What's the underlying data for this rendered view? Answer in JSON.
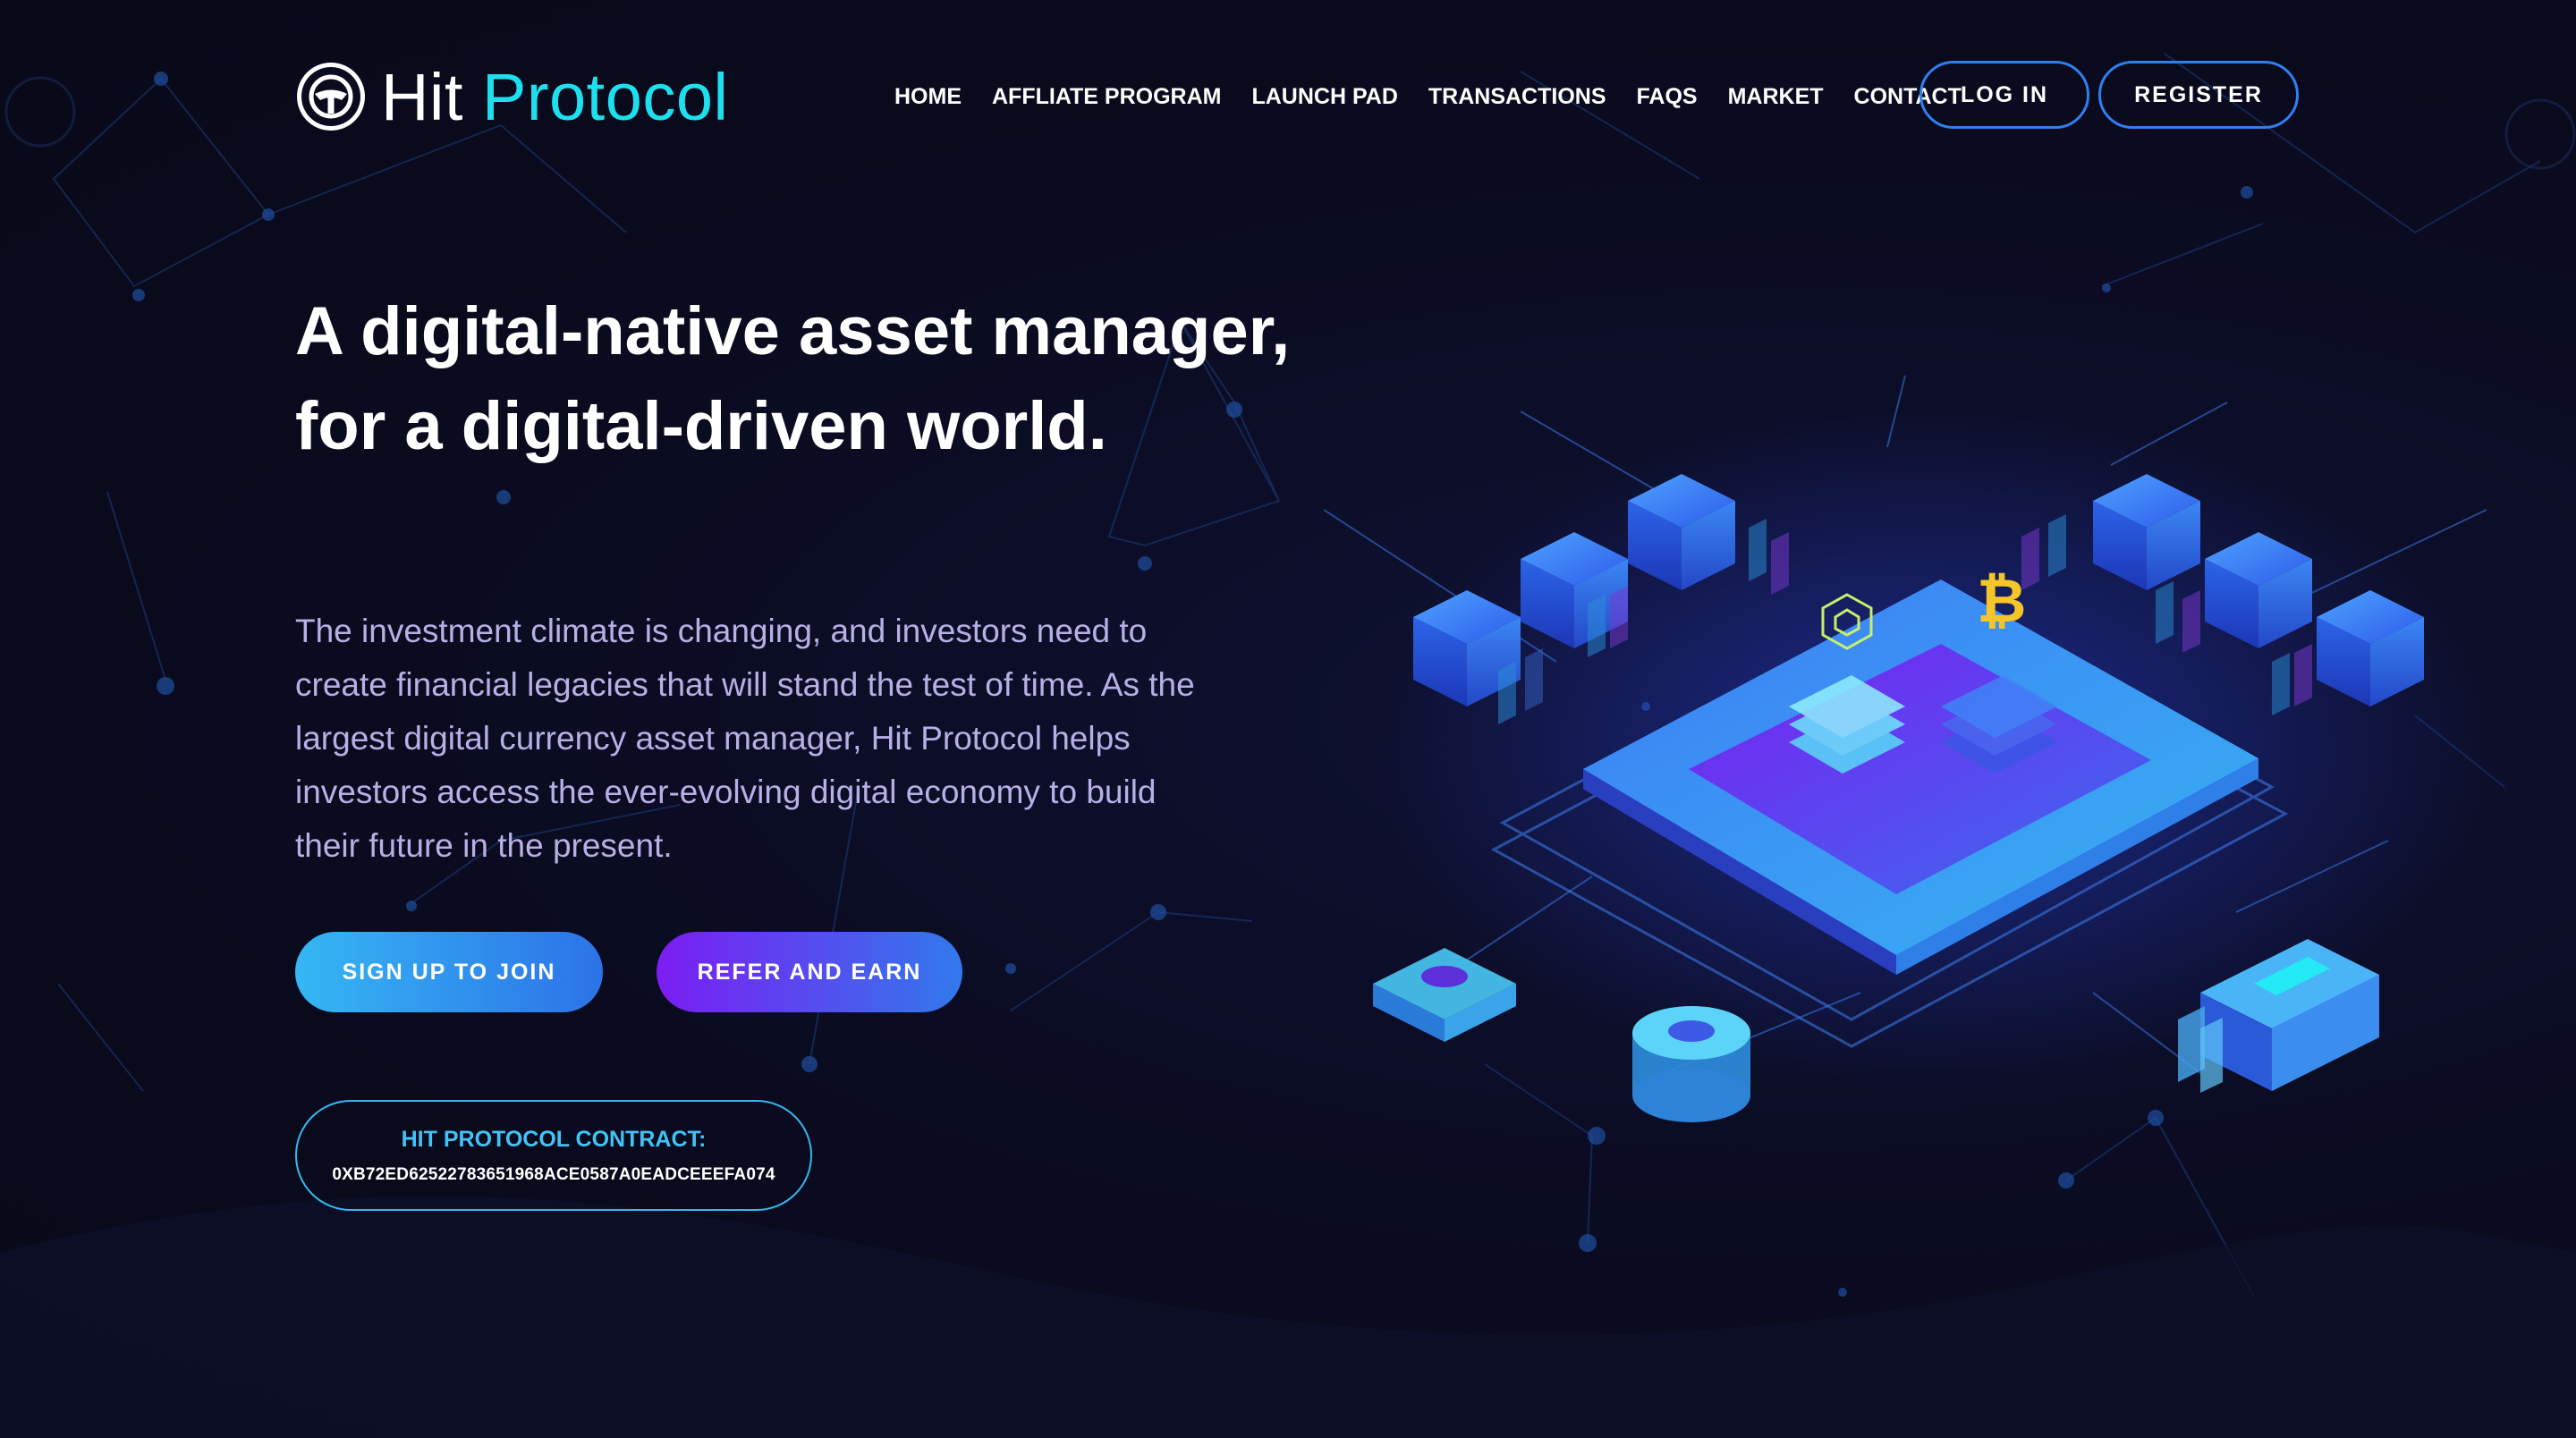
{
  "brand": {
    "name_part1": "Hit",
    "name_part2": "Protocol",
    "logo_icon": "hit-protocol-logo-icon",
    "accent_color": "#1de0ee"
  },
  "nav": {
    "items": [
      {
        "label": "HOME"
      },
      {
        "label": "AFFLIATE PROGRAM"
      },
      {
        "label": "LAUNCH PAD"
      },
      {
        "label": "TRANSACTIONS"
      },
      {
        "label": "FAQS"
      },
      {
        "label": "MARKET"
      },
      {
        "label": "CONTACT"
      }
    ],
    "login_label": "LOG IN",
    "register_label": "REGISTER"
  },
  "hero": {
    "title": "A digital-native asset manager, for a digital-driven world.",
    "description": "The investment climate is changing, and investors need to create financial legacies that will stand the test of time. As the largest digital currency asset manager, Hit Protocol helps investors access the ever-evolving digital economy to build their future in the present.",
    "signup_label": "SIGN UP TO JOIN",
    "refer_label": "REFER AND EARN",
    "contract": {
      "label": "HIT PROTOCOL CONTRACT:",
      "address": "0XB72ED62522783651968ACE0587A0EADCEEEFA074"
    },
    "illustration_icon": "isometric-blockchain-illustration"
  },
  "colors": {
    "background": "#0a0b1f",
    "primary_blue": "#2f7ff0",
    "purple": "#7b1df2",
    "cyan": "#36b6f1",
    "bitcoin_gold": "#f4c62a"
  }
}
